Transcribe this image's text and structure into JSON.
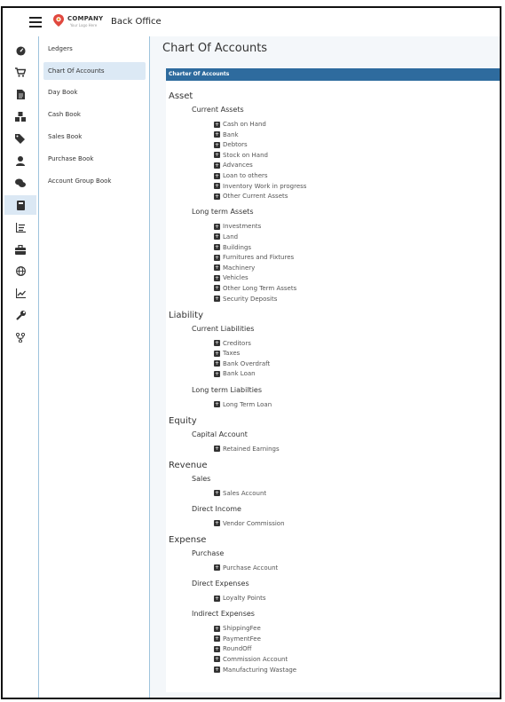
{
  "header": {
    "logo_text": "COMPANY",
    "logo_sub": "Your Logo Here",
    "app_title": "Back Office"
  },
  "iconbar": [
    {
      "icon": "dashboard-icon"
    },
    {
      "icon": "cart-icon"
    },
    {
      "icon": "document-icon"
    },
    {
      "icon": "boxes-icon"
    },
    {
      "icon": "tags-icon"
    },
    {
      "icon": "user-icon"
    },
    {
      "icon": "chat-icon"
    },
    {
      "icon": "book-icon",
      "active": true
    },
    {
      "icon": "list-icon"
    },
    {
      "icon": "toolbox-icon"
    },
    {
      "icon": "globe-icon"
    },
    {
      "icon": "chart-icon"
    },
    {
      "icon": "wrench-icon"
    },
    {
      "icon": "fork-icon"
    }
  ],
  "menu": {
    "items": [
      {
        "label": "Ledgers"
      },
      {
        "label": "Chart Of Accounts",
        "active": true
      },
      {
        "label": "Day Book"
      },
      {
        "label": "Cash Book"
      },
      {
        "label": "Sales Book"
      },
      {
        "label": "Purchase Book"
      },
      {
        "label": "Account Group Book"
      }
    ]
  },
  "page": {
    "title": "Chart Of Accounts",
    "card_title": "Charter Of Accounts"
  },
  "accounts": [
    {
      "name": "Asset",
      "groups": [
        {
          "name": "Current Assets",
          "items": [
            "Cash on Hand",
            "Bank",
            "Debtors",
            "Stock on Hand",
            "Advances",
            "Loan to others",
            "Inventory Work in progress",
            "Other Current Assets"
          ]
        },
        {
          "name": "Long term Assets",
          "items": [
            "Investments",
            "Land",
            "Buildings",
            "Furnitures and Fixtures",
            "Machinery",
            "Vehicles",
            "Other Long Term Assets",
            "Security Deposits"
          ]
        }
      ]
    },
    {
      "name": "Liability",
      "groups": [
        {
          "name": "Current Liabilities",
          "items": [
            "Creditors",
            "Taxes",
            "Bank Overdraft",
            "Bank Loan"
          ]
        },
        {
          "name": "Long term Liabilties",
          "items": [
            "Long Term Loan"
          ]
        }
      ]
    },
    {
      "name": "Equity",
      "groups": [
        {
          "name": "Capital Account",
          "items": [
            "Retained Earnings"
          ]
        }
      ]
    },
    {
      "name": "Revenue",
      "groups": [
        {
          "name": "Sales",
          "items": [
            "Sales Account"
          ]
        },
        {
          "name": "Direct Income",
          "items": [
            "Vendor Commission"
          ]
        }
      ]
    },
    {
      "name": "Expense",
      "groups": [
        {
          "name": "Purchase",
          "items": [
            "Purchase Account"
          ]
        },
        {
          "name": "Direct Expenses",
          "items": [
            "Loyalty Points"
          ]
        },
        {
          "name": "Indirect Expenses",
          "items": [
            "ShippingFee",
            "PaymentFee",
            "RoundOff",
            "Commission Account",
            "Manufacturing Wastage"
          ]
        }
      ]
    }
  ]
}
